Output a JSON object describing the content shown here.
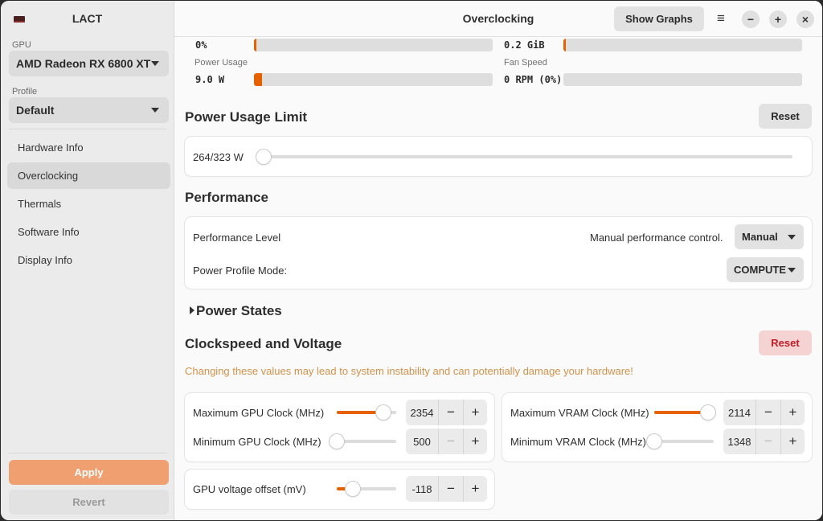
{
  "app": {
    "title": "LACT"
  },
  "sidebar": {
    "gpu_label": "GPU",
    "gpu_value": "AMD Radeon RX 6800 XT",
    "profile_label": "Profile",
    "profile_value": "Default",
    "items": [
      {
        "label": "Hardware Info"
      },
      {
        "label": "Overclocking"
      },
      {
        "label": "Thermals"
      },
      {
        "label": "Software Info"
      },
      {
        "label": "Display Info"
      }
    ],
    "apply_label": "Apply",
    "revert_label": "Revert"
  },
  "header": {
    "title": "Overclocking",
    "show_graphs_label": "Show Graphs",
    "menu_icon": "≡",
    "minimize_icon": "−",
    "maximize_icon": "+",
    "close_icon": "×"
  },
  "stats": {
    "top_left_value": "0%",
    "top_left_fraction": 0.01,
    "top_right_value": "0.2 GiB",
    "top_right_fraction": 0.01,
    "power_usage_label": "Power Usage",
    "power_usage_value": "9.0 W",
    "power_usage_fraction": 0.035,
    "fan_speed_label": "Fan Speed",
    "fan_speed_value": "0 RPM (0%)",
    "fan_speed_fraction": 0.0
  },
  "power_limit": {
    "title": "Power Usage Limit",
    "reset_label": "Reset",
    "value": "264/323 W",
    "fraction": 0.0
  },
  "performance": {
    "title": "Performance",
    "level_label": "Performance Level",
    "manual_hint": "Manual performance control.",
    "level_value": "Manual",
    "profile_mode_label": "Power Profile Mode:",
    "profile_mode_value": "COMPUTE"
  },
  "power_states": {
    "title": "Power States"
  },
  "clocks": {
    "title": "Clockspeed and Voltage",
    "reset_label": "Reset",
    "warning": "Changing these values may lead to system instability and can potentially damage your hardware!",
    "max_gpu": {
      "label": "Maximum GPU Clock (MHz)",
      "value": "2354",
      "fraction": 0.78
    },
    "min_gpu": {
      "label": "Minimum GPU Clock (MHz)",
      "value": "500",
      "fraction": 0.0
    },
    "max_vram": {
      "label": "Maximum VRAM Clock (MHz)",
      "value": "2114",
      "fraction": 0.9
    },
    "min_vram": {
      "label": "Minimum VRAM Clock (MHz)",
      "value": "1348",
      "fraction": 0.0
    },
    "voltage_offset": {
      "label": "GPU voltage offset (mV)",
      "value": "-118",
      "fraction": 0.27
    },
    "minus_icon": "−",
    "plus_icon": "+"
  },
  "colors": {
    "accent": "#e66100",
    "apply_bg": "#f0a070",
    "danger": "#c01c28",
    "warning": "#d3924a"
  }
}
